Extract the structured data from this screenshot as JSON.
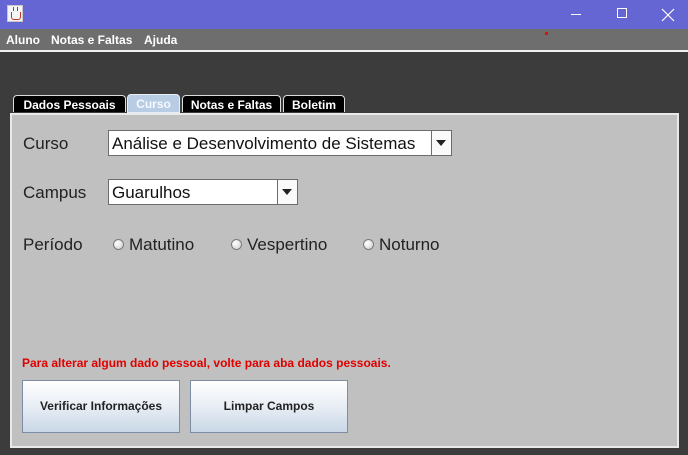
{
  "window": {
    "title": ""
  },
  "menubar": {
    "items": [
      {
        "label": "Aluno"
      },
      {
        "label": "Notas e Faltas"
      },
      {
        "label": "Ajuda"
      }
    ]
  },
  "tabs": [
    {
      "label": "Dados Pessoais",
      "selected": false
    },
    {
      "label": "Curso",
      "selected": true
    },
    {
      "label": "Notas e Faltas",
      "selected": false
    },
    {
      "label": "Boletim",
      "selected": false
    }
  ],
  "form": {
    "curso": {
      "label": "Curso",
      "value": "Análise e Desenvolvimento de Sistemas"
    },
    "campus": {
      "label": "Campus",
      "value": "Guarulhos"
    },
    "periodo": {
      "label": "Período",
      "options": [
        {
          "label": "Matutino",
          "checked": false
        },
        {
          "label": "Vespertino",
          "checked": false
        },
        {
          "label": "Noturno",
          "checked": false
        }
      ]
    },
    "warning": "Para alterar algum dado pessoal, volte para aba dados pessoais."
  },
  "buttons": {
    "verificar": "Verificar Informações",
    "limpar": "Limpar Campos"
  },
  "colors": {
    "titlebar": "#6565d4",
    "menubar": "#6e6e6e",
    "panel": "#c0c0c0",
    "warning": "#e00000"
  }
}
